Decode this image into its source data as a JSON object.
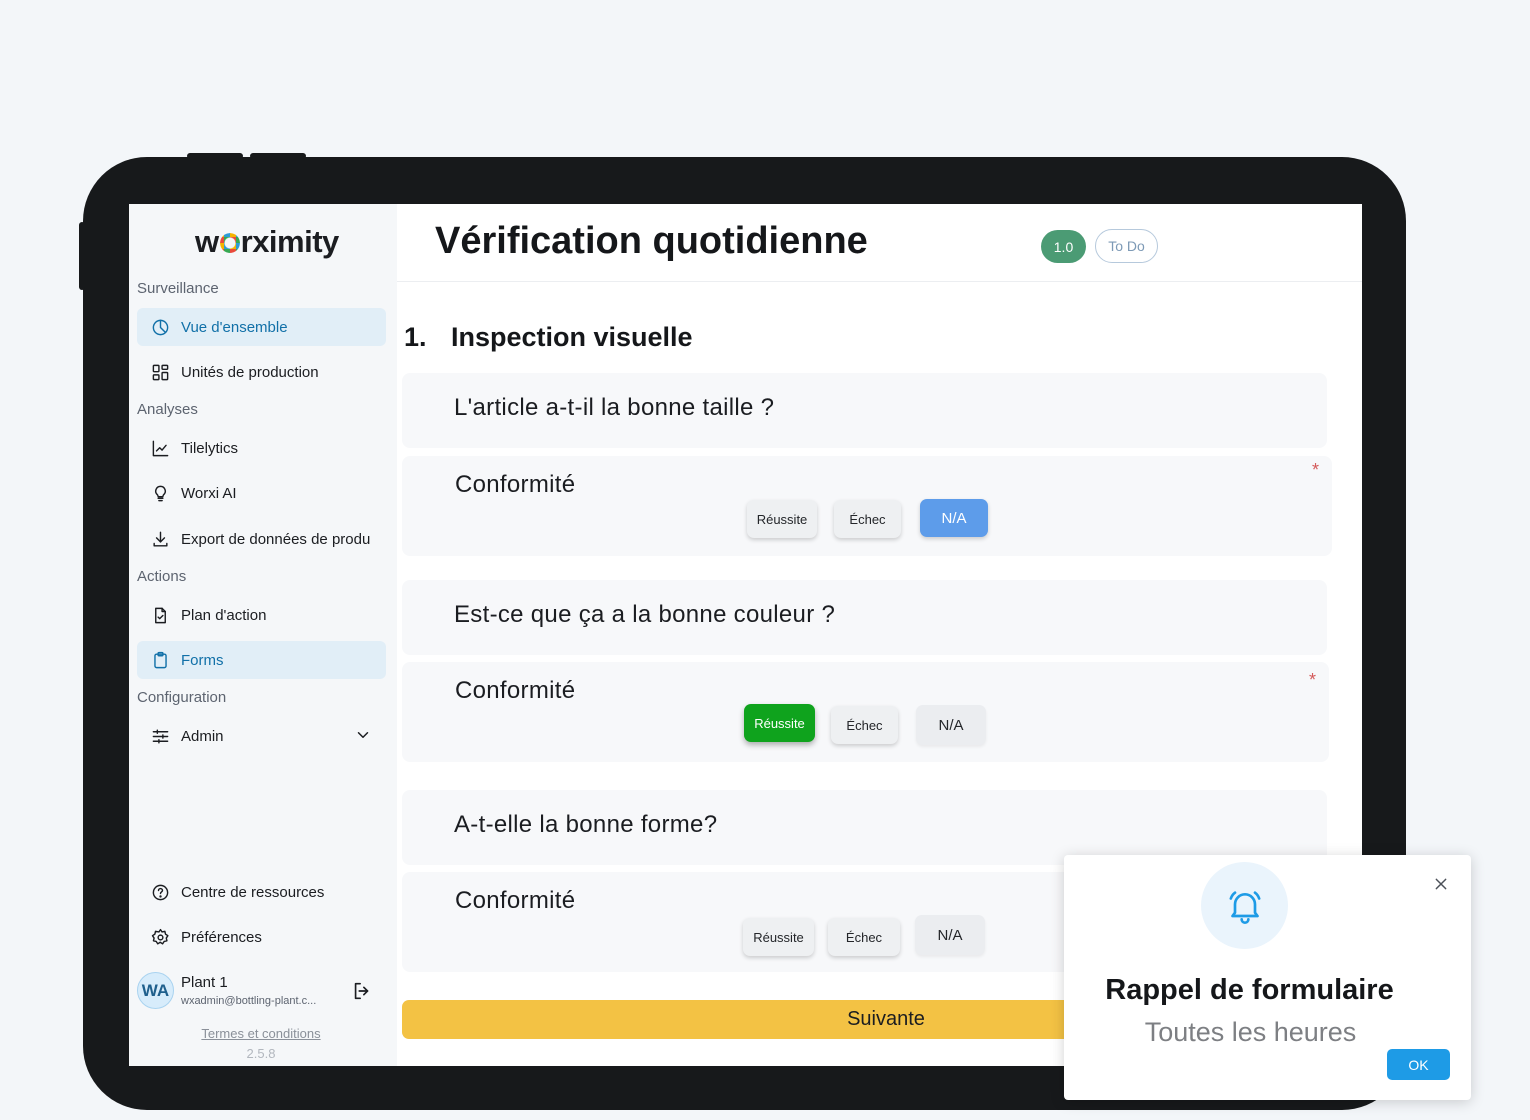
{
  "app": {
    "logo_text": "worximity"
  },
  "sidebar": {
    "sections": [
      {
        "label": "Surveillance"
      },
      {
        "label": "Analyses"
      },
      {
        "label": "Actions"
      },
      {
        "label": "Configuration"
      }
    ],
    "items": [
      {
        "label": "Vue d'ensemble",
        "icon": "pie-chart-icon",
        "active": true
      },
      {
        "label": "Unités de production",
        "icon": "grid-icon"
      },
      {
        "label": "Tilelytics",
        "icon": "line-chart-icon"
      },
      {
        "label": "Worxi AI",
        "icon": "lightbulb-icon"
      },
      {
        "label": "Export de données de produ",
        "icon": "download-icon"
      },
      {
        "label": "Plan d'action",
        "icon": "file-check-icon"
      },
      {
        "label": "Forms",
        "icon": "clipboard-icon",
        "active": true
      },
      {
        "label": "Admin",
        "icon": "sliders-icon"
      },
      {
        "label": "Centre de ressources",
        "icon": "help-circle-icon"
      },
      {
        "label": "Préférences",
        "icon": "gear-icon"
      }
    ],
    "user": {
      "initials": "WA",
      "name": "Plant 1",
      "email": "wxadmin@bottling-plant.c..."
    },
    "terms": "Termes et conditions",
    "version": "2.5.8"
  },
  "header": {
    "title": "Vérification quotidienne",
    "version_badge": "1.0",
    "status_badge": "To Do"
  },
  "section": {
    "number": "1.",
    "title": "Inspection visuelle"
  },
  "questions": [
    {
      "text": "L'article a-t-il la bonne taille ?",
      "answer_label": "Conformité",
      "required": "*",
      "options": [
        "Réussite",
        "Échec",
        "N/A"
      ],
      "selected": "N/A"
    },
    {
      "text": "Est-ce que ça a la bonne couleur ?",
      "answer_label": "Conformité",
      "required": "*",
      "options": [
        "Réussite",
        "Échec",
        "N/A"
      ],
      "selected": "Réussite"
    },
    {
      "text": "A-t-elle la bonne forme?",
      "answer_label": "Conformité",
      "options": [
        "Réussite",
        "Échec",
        "N/A"
      ],
      "selected": ""
    }
  ],
  "next_button": "Suivante",
  "notification": {
    "title": "Rappel de formulaire",
    "subtitle": "Toutes les heures",
    "ok_label": "OK"
  },
  "colors": {
    "accent": "#1170a8",
    "pass": "#0fa31d",
    "na_selected": "#5d9cea",
    "next": "#f3c244",
    "version_badge": "#4b9b74"
  }
}
